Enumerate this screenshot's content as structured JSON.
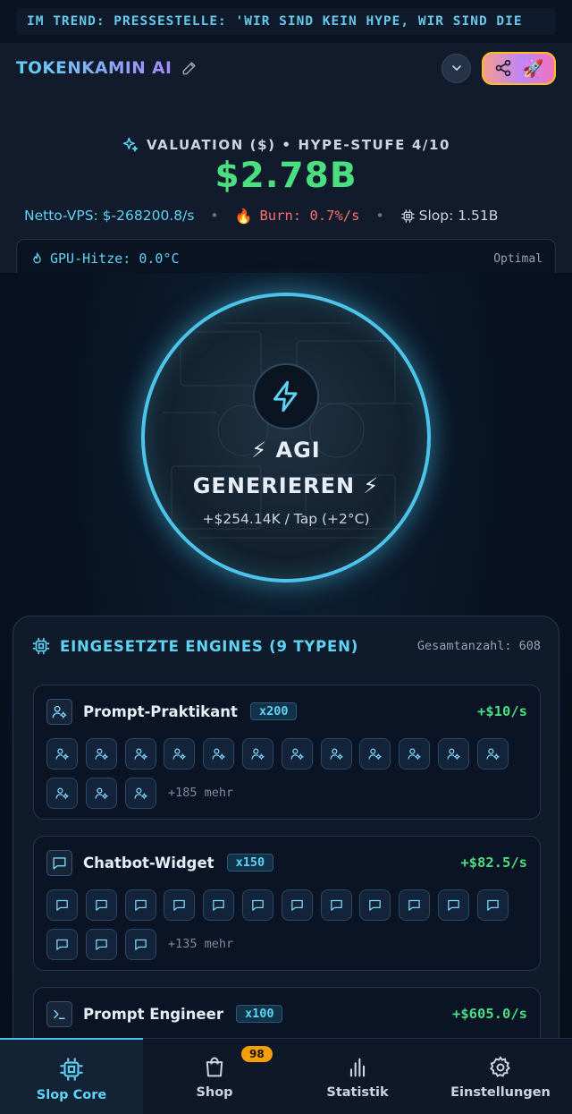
{
  "ticker": {
    "text": "IM TREND: PRESSESTELLE: 'WIR SIND KEIN HYPE, WIR SIND DIE"
  },
  "header": {
    "brand": "TOKENKAMIN AI",
    "valuation_label": "VALUATION ($) • HYPE-STUFE 4/10",
    "valuation_amount": "$2.78B",
    "net_vps": "Netto-VPS: $-268200.8/s",
    "burn": "Burn: 0.7%/s",
    "slop": "Slop: 1.51B",
    "icons": {
      "edit": "pencil-icon",
      "dropdown": "chevron-down-icon",
      "share": "share-icon",
      "rocket": "rocket-emoji",
      "sparkle": "sparkle-icon",
      "fire": "fire-emoji",
      "chip": "chip-icon"
    }
  },
  "gpu": {
    "label": "GPU-Hitze: 0.0°C",
    "status": "Optimal",
    "level_fraction": 0.0,
    "fill_color": "#fb923c"
  },
  "core": {
    "title_line1": "⚡ AGI",
    "title_line2": "GENERIEREN ⚡",
    "subtitle": "+$254.14K / Tap (+2°C)",
    "accent": "#4cc4ea"
  },
  "engines": {
    "title": "EINGESETZTE ENGINES (9 TYPEN)",
    "total": "Gesamtanzahl: 608",
    "items": [
      {
        "name": "Prompt-Praktikant",
        "count": "x200",
        "rate": "+$10/s",
        "icon": "user-gear-icon",
        "more": "+185 mehr"
      },
      {
        "name": "Chatbot-Widget",
        "count": "x150",
        "rate": "+$82.5/s",
        "icon": "chat-bubble-icon",
        "more": "+135 mehr"
      },
      {
        "name": "Prompt Engineer",
        "count": "x100",
        "rate": "+$605.0/s",
        "icon": "terminal-icon",
        "more": ""
      }
    ]
  },
  "nav": {
    "items": [
      {
        "label": "Slop Core",
        "icon": "chip-icon"
      },
      {
        "label": "Shop",
        "icon": "shopping-bag-icon",
        "badge": "98"
      },
      {
        "label": "Statistik",
        "icon": "bar-chart-icon"
      },
      {
        "label": "Einstellungen",
        "icon": "gear-icon"
      }
    ]
  },
  "colors": {
    "accent": "#5fd3f3",
    "money": "#4ade80",
    "burn": "#f87171",
    "badge": "#f59e0b"
  }
}
